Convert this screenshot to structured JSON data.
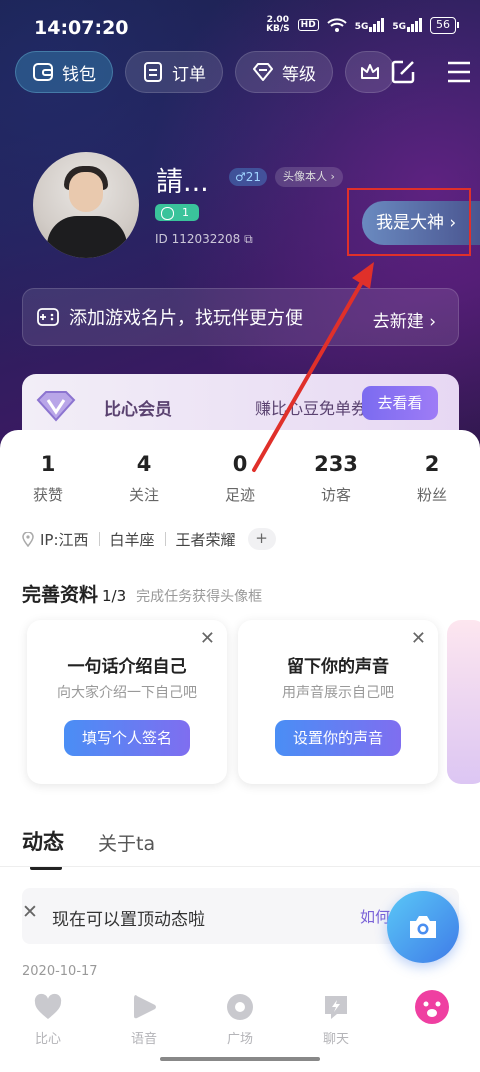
{
  "status_bar": {
    "time": "14:07:20",
    "speed_value": "2.00",
    "speed_unit": "KB/S",
    "hd": "HD",
    "sig1": "5G",
    "sig2": "5G",
    "battery": "56"
  },
  "top_bar": {
    "wallet": "钱包",
    "orders": "订单",
    "level": "等级",
    "icons": [
      "crown-icon",
      "edit-icon",
      "menu-icon"
    ]
  },
  "profile": {
    "name": "請...",
    "gender_age": "♂21",
    "verified": "头像本人",
    "level": "1",
    "id": "ID 112032208",
    "dashen_button": "我是大神"
  },
  "game_card": {
    "text": "添加游戏名片，找玩伴更方便",
    "action": "去新建"
  },
  "vip": {
    "label": "比心会员",
    "tagline": "赚比心豆免单券",
    "button": "去看看"
  },
  "stats": [
    {
      "value": "1",
      "label": "获赞"
    },
    {
      "value": "4",
      "label": "关注"
    },
    {
      "value": "0",
      "label": "足迹"
    },
    {
      "value": "233",
      "label": "访客"
    },
    {
      "value": "2",
      "label": "粉丝"
    }
  ],
  "tags": {
    "ip": "IP:江西",
    "zodiac": "白羊座",
    "game": "王者荣耀",
    "plus": "+"
  },
  "complete_profile": {
    "title": "完善资料",
    "progress": "1/3",
    "subtitle": "完成任务获得头像框"
  },
  "tasks": [
    {
      "title": "一句话介绍自己",
      "desc": "向大家介绍一下自己吧",
      "button": "填写个人签名"
    },
    {
      "title": "留下你的声音",
      "desc": "用声音展示自己吧",
      "button": "设置你的声音"
    }
  ],
  "tabs": {
    "feed": "动态",
    "about": "关于ta"
  },
  "notice": {
    "text": "现在可以置顶动态啦",
    "link": "如何"
  },
  "post_date": "2020-10-17",
  "bottom_nav": [
    {
      "label": "比心",
      "icon": "heart-icon"
    },
    {
      "label": "语音",
      "icon": "play-icon"
    },
    {
      "label": "广场",
      "icon": "record-icon"
    },
    {
      "label": "聊天",
      "icon": "chat-icon"
    },
    {
      "label": "",
      "icon": "face-icon"
    }
  ],
  "colors": {
    "accent": "#7a62d8",
    "annotation_red": "#e0302a",
    "level_green": "#3ac39b"
  }
}
